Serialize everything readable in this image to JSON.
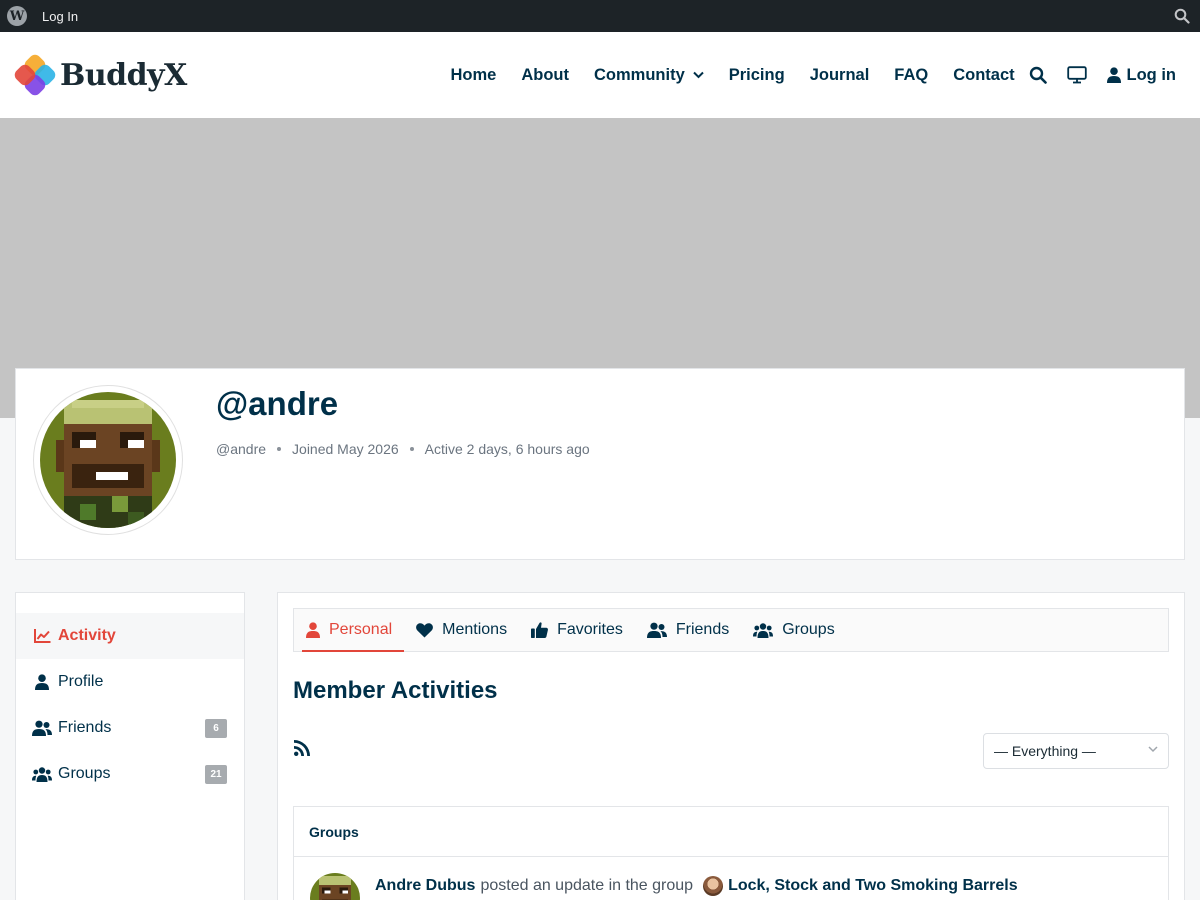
{
  "admin_bar": {
    "login_label": "Log In"
  },
  "header": {
    "logo_text": "BuddyX",
    "nav": [
      "Home",
      "About",
      "Community",
      "Pricing",
      "Journal",
      "FAQ",
      "Contact"
    ],
    "login_label": "Log in"
  },
  "profile": {
    "name": "@andre",
    "handle": "@andre",
    "joined": "Joined May 2026",
    "active": "Active 2 days, 6 hours ago"
  },
  "sidebar": {
    "items": [
      {
        "label": "Activity",
        "icon": "chart-line-icon",
        "active": true
      },
      {
        "label": "Profile",
        "icon": "user-icon"
      },
      {
        "label": "Friends",
        "icon": "user-friends-icon",
        "count": "6"
      },
      {
        "label": "Groups",
        "icon": "users-group-icon",
        "count": "21"
      }
    ]
  },
  "subnav": {
    "items": [
      {
        "label": "Personal",
        "icon": "user-icon",
        "active": true
      },
      {
        "label": "Mentions",
        "icon": "heart-icon"
      },
      {
        "label": "Favorites",
        "icon": "thumbs-up-icon"
      },
      {
        "label": "Friends",
        "icon": "user-friends-icon"
      },
      {
        "label": "Groups",
        "icon": "users-group-icon"
      }
    ]
  },
  "main": {
    "section_title": "Member Activities",
    "filter_value": "— Everything —",
    "activity_head": "Groups",
    "activity": {
      "author": "Andre Dubus",
      "action": "posted an update in the group",
      "group": "Lock, Stock and Two Smoking Barrels"
    }
  },
  "colors": {
    "accent": "#e2463a",
    "navy": "#003049",
    "cover": "#c4c4c4",
    "adminbar": "#1d2327"
  }
}
